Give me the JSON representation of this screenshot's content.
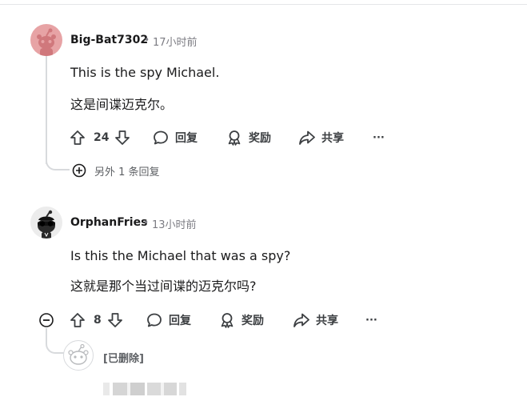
{
  "comments": [
    {
      "username": "Big-Bat7302",
      "separator": "•",
      "time": "17小时前",
      "text_en": "This is the spy Michael.",
      "text_zh": "这是间谍迈克尔。",
      "votes": "24",
      "reply_label": "回复",
      "award_label": "奖励",
      "share_label": "共享",
      "more_label": "···",
      "more_replies": "另外 1 条回复"
    },
    {
      "username": "OrphanFries",
      "separator": "•",
      "time": "13小时前",
      "text_en": "Is this the Michael that was a spy?",
      "text_zh": "这就是那个当过间谍的迈克尔吗?",
      "votes": "8",
      "reply_label": "回复",
      "award_label": "奖励",
      "share_label": "共享",
      "more_label": "···"
    }
  ],
  "deleted_reply": {
    "label": "[已删除]"
  },
  "colors": {
    "avatar1": "#e7a3a5",
    "avatar2": "#ececec",
    "thread_line": "#d8dadd",
    "meta_text": "#7c7c83"
  },
  "icons": [
    "upvote-icon",
    "downvote-icon",
    "reply-icon",
    "award-icon",
    "share-icon",
    "more-icon",
    "expand-icon",
    "collapse-icon"
  ]
}
